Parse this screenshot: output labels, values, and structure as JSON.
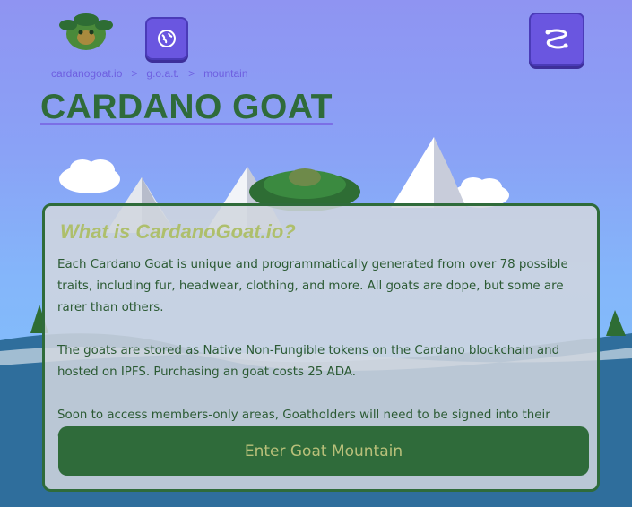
{
  "header": {
    "logo_icon": "goat-logo-icon",
    "globe_button_icon": "globe-icon",
    "menu_button_icon": "menu-squiggle-icon"
  },
  "breadcrumb": {
    "items": [
      "cardanogoat.io",
      "g.o.a.t.",
      "mountain"
    ],
    "separator": ">"
  },
  "page": {
    "title": "CARDANO GOAT"
  },
  "card": {
    "title": "What is CardanoGoat.io?",
    "paragraphs": [
      "Each Cardano Goat is unique and programmatically generated from over 78 possible traits, including fur, headwear, clothing, and more. All goats are dope, but some are rarer than others.",
      "The goats are stored as Native Non-Fungible tokens on the Cardano blockchain and hosted on IPFS. Purchasing an goat costs 25 ADA.",
      "Soon to access members-only areas, Goatholders will need to be signed into their Cardano Wallet."
    ],
    "button_label": "Enter Goat Mountain"
  },
  "colors": {
    "accent_green": "#2f6b3a",
    "button_purple": "#6a56e0",
    "title_olive": "#aebf6c"
  }
}
